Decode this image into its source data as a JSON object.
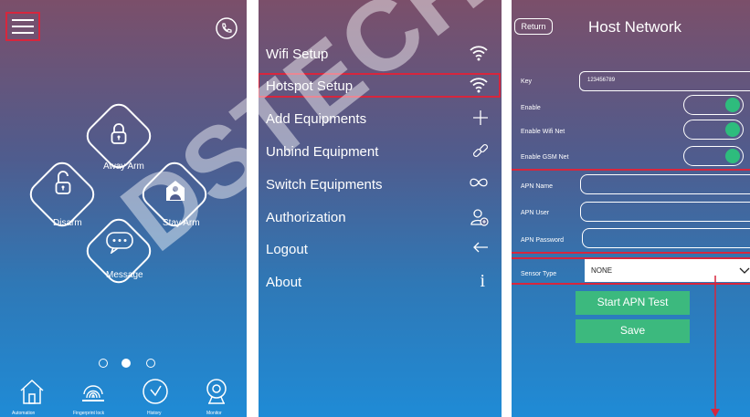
{
  "home": {
    "actions": [
      "Away Arm",
      "Disarm",
      "Stay Arm",
      "Message"
    ],
    "tabs": [
      "Automation",
      "Fingerprint lock",
      "History",
      "Monitor"
    ],
    "page_dots": 3,
    "active_dot": 1
  },
  "menu": {
    "items": [
      {
        "label": "Wifi Setup",
        "icon": "wifi-icon"
      },
      {
        "label": "Hotspot Setup",
        "icon": "wifi-icon"
      },
      {
        "label": "Add Equipments",
        "icon": "plus-icon"
      },
      {
        "label": "Unbind Equipment",
        "icon": "link-icon"
      },
      {
        "label": "Switch Equipments",
        "icon": "infinity-icon"
      },
      {
        "label": "Authorization",
        "icon": "user-add-icon"
      },
      {
        "label": "Logout",
        "icon": "arrow-left-icon"
      },
      {
        "label": "About",
        "icon": "info-icon"
      }
    ]
  },
  "host": {
    "return_label": "Return",
    "title": "Host Network",
    "key_label": "Key",
    "key_value": "123456789",
    "enable_label": "Enable",
    "enable_wifi_label": "Enable Wifi Net",
    "enable_gsm_label": "Enable GSM Net",
    "apn_name_label": "APN Name",
    "apn_user_label": "APN User",
    "apn_password_label": "APN Password",
    "sensor_type_label": "Sensor Type",
    "sensor_type_value": "NONE",
    "start_test_label": "Start APN Test",
    "save_label": "Save"
  },
  "watermark": "DSTECHNIKS",
  "colors": {
    "accent": "#3cb97e",
    "highlight": "#d7263d"
  }
}
